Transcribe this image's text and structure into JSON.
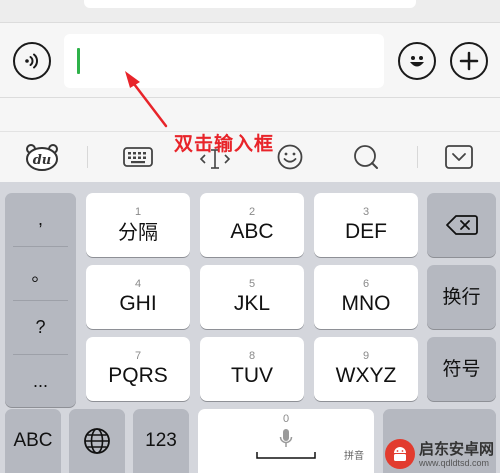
{
  "annotation": {
    "text": "双击输入框"
  },
  "input_bar": {
    "value": ""
  },
  "keyboard": {
    "punctuation": [
      ",",
      "。",
      "?",
      "..."
    ],
    "keys": [
      {
        "num": "1",
        "label": "分隔"
      },
      {
        "num": "2",
        "label": "ABC"
      },
      {
        "num": "3",
        "label": "DEF"
      },
      {
        "num": "4",
        "label": "GHI"
      },
      {
        "num": "5",
        "label": "JKL"
      },
      {
        "num": "6",
        "label": "MNO"
      },
      {
        "num": "7",
        "label": "PQRS"
      },
      {
        "num": "8",
        "label": "TUV"
      },
      {
        "num": "9",
        "label": "WXYZ"
      }
    ],
    "wrap_label": "换行",
    "symbol_label": "符号",
    "bottom_row": {
      "abc": "ABC",
      "num_123": "123",
      "space_num": "0",
      "space_hint": "拼音"
    }
  },
  "watermark": {
    "title": "启东安卓网",
    "url": "www.qdldtsd.com"
  },
  "icons": {
    "voice": "voice-icon",
    "emoji": "smiley-icon",
    "plus": "plus-icon",
    "toolbar": [
      "du-logo-icon",
      "keyboard-icon",
      "cursor-move-icon",
      "smiley-icon",
      "search-icon",
      "collapse-keyboard-icon"
    ],
    "backspace": "backspace-icon",
    "globe": "globe-icon",
    "mic": "microphone-icon"
  },
  "colors": {
    "cursor": "#2fb24a",
    "annotation": "#e8242a",
    "keyboard_bg": "#d4d6dc",
    "dark_key": "#b5b8c0"
  }
}
